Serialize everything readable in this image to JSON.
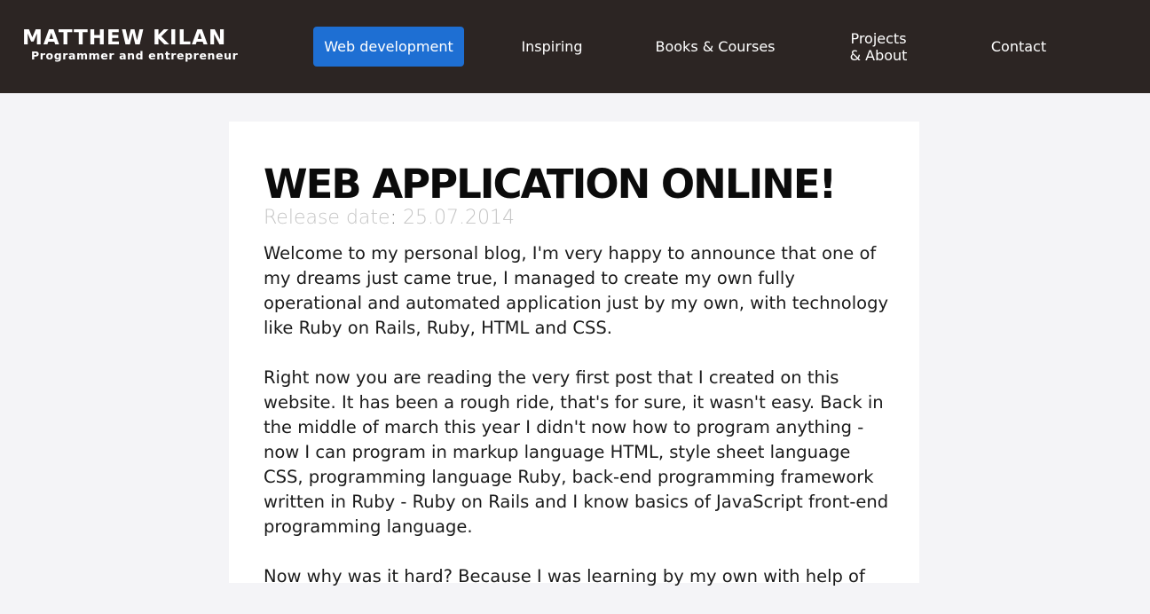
{
  "brand": {
    "name": "MATTHEW KILAN",
    "tagline": "Programmer and entrepreneur"
  },
  "nav": {
    "items": [
      {
        "label": "Web development",
        "active": true
      },
      {
        "label": "Inspiring",
        "active": false
      },
      {
        "label": "Books & Courses",
        "active": false
      },
      {
        "label_line1": "Projects",
        "label_line2": "& About",
        "active": false
      },
      {
        "label": "Contact",
        "active": false
      }
    ]
  },
  "post": {
    "title": "WEB APPLICATION ONLINE!",
    "release_label": "Release date",
    "release_separator": ":",
    "release_date": "25.07.2014",
    "paragraphs": [
      "Welcome to my personal blog, I'm very happy to announce that one of my dreams just came true, I managed to create my own fully operational and automated application just by my own, with technology like Ruby on Rails, Ruby, HTML and CSS.",
      "Right now you are reading the very first post that I created on this website. It has been a rough ride, that's for sure, it wasn't easy. Back in the middle of march this year I didn't now how to program anything - now I can program in markup language HTML, style sheet language CSS, programming language Ruby, back-end programming framework written in Ruby - Ruby on Rails and I know basics of JavaScript front-end programming language.",
      "Now why was it hard? Because I was learning by my own with help of"
    ]
  },
  "colors": {
    "header_bg": "#2c2523",
    "active_nav_bg": "#1e6fd3",
    "page_bg": "#f4f4f7",
    "card_bg": "#ffffff"
  }
}
